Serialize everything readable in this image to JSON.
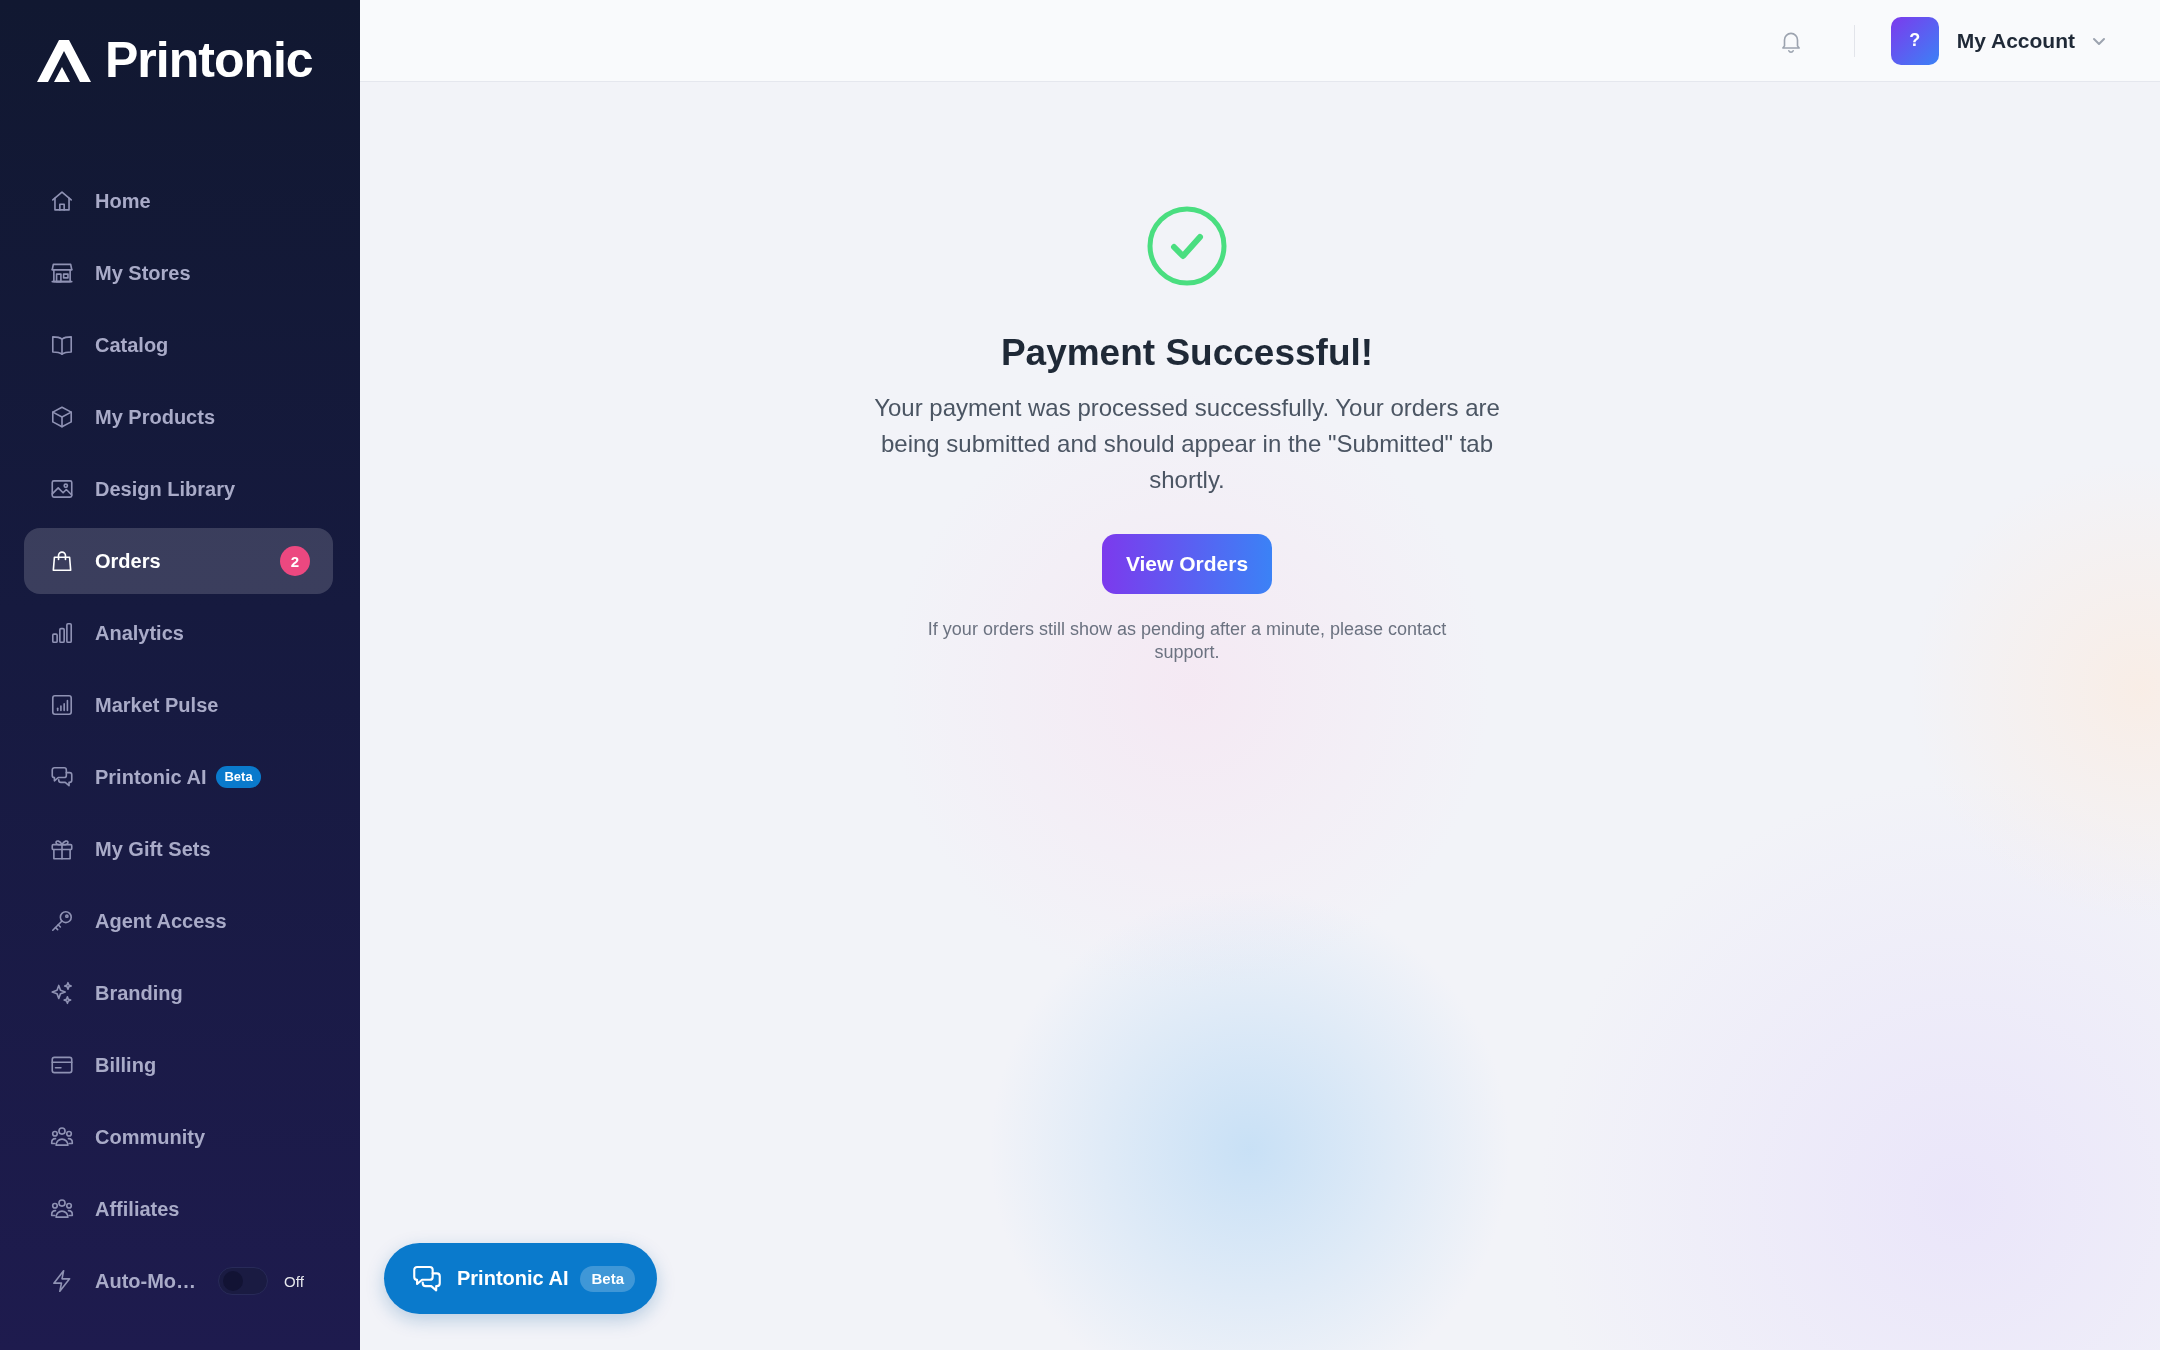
{
  "sidebar": {
    "logo": "Printonic",
    "items": [
      {
        "kind": "link",
        "label": "Home",
        "selected": false
      },
      {
        "kind": "link",
        "label": "My Stores",
        "selected": false
      },
      {
        "kind": "link",
        "label": "Catalog",
        "selected": false
      },
      {
        "kind": "link",
        "label": "My Products",
        "selected": false
      },
      {
        "kind": "link",
        "label": "Design Library",
        "selected": false
      },
      {
        "kind": "link",
        "label": "Orders",
        "selected": true,
        "badge": "2"
      },
      {
        "kind": "link",
        "label": "Analytics",
        "selected": false
      },
      {
        "kind": "link",
        "label": "Market Pulse",
        "selected": false
      },
      {
        "kind": "link",
        "label": "Printonic AI",
        "selected": false,
        "tag": "Beta"
      },
      {
        "kind": "link",
        "label": "My Gift Sets",
        "selected": false
      },
      {
        "kind": "link",
        "label": "Agent Access",
        "selected": false
      },
      {
        "kind": "link",
        "label": "Branding",
        "selected": false
      },
      {
        "kind": "link",
        "label": "Billing",
        "selected": false
      },
      {
        "kind": "link",
        "label": "Community",
        "selected": false
      },
      {
        "kind": "link",
        "label": "Affiliates",
        "selected": false
      },
      {
        "kind": "toggle",
        "label": "Auto-Mo…",
        "selected": false,
        "on": false,
        "state": "Off"
      }
    ]
  },
  "top_bar": {
    "account": {
      "avatar": "?",
      "name": "My Account"
    }
  },
  "confirmation": {
    "title": "Payment Successful!",
    "message": "Your payment was processed successfully. Your orders are being submitted and should appear in the \"Submitted\" tab shortly.",
    "button": "View Orders",
    "note": "If your orders still show as pending after a minute, please contact support."
  },
  "chat_button": {
    "label": "Printonic AI",
    "tag": "Beta"
  }
}
